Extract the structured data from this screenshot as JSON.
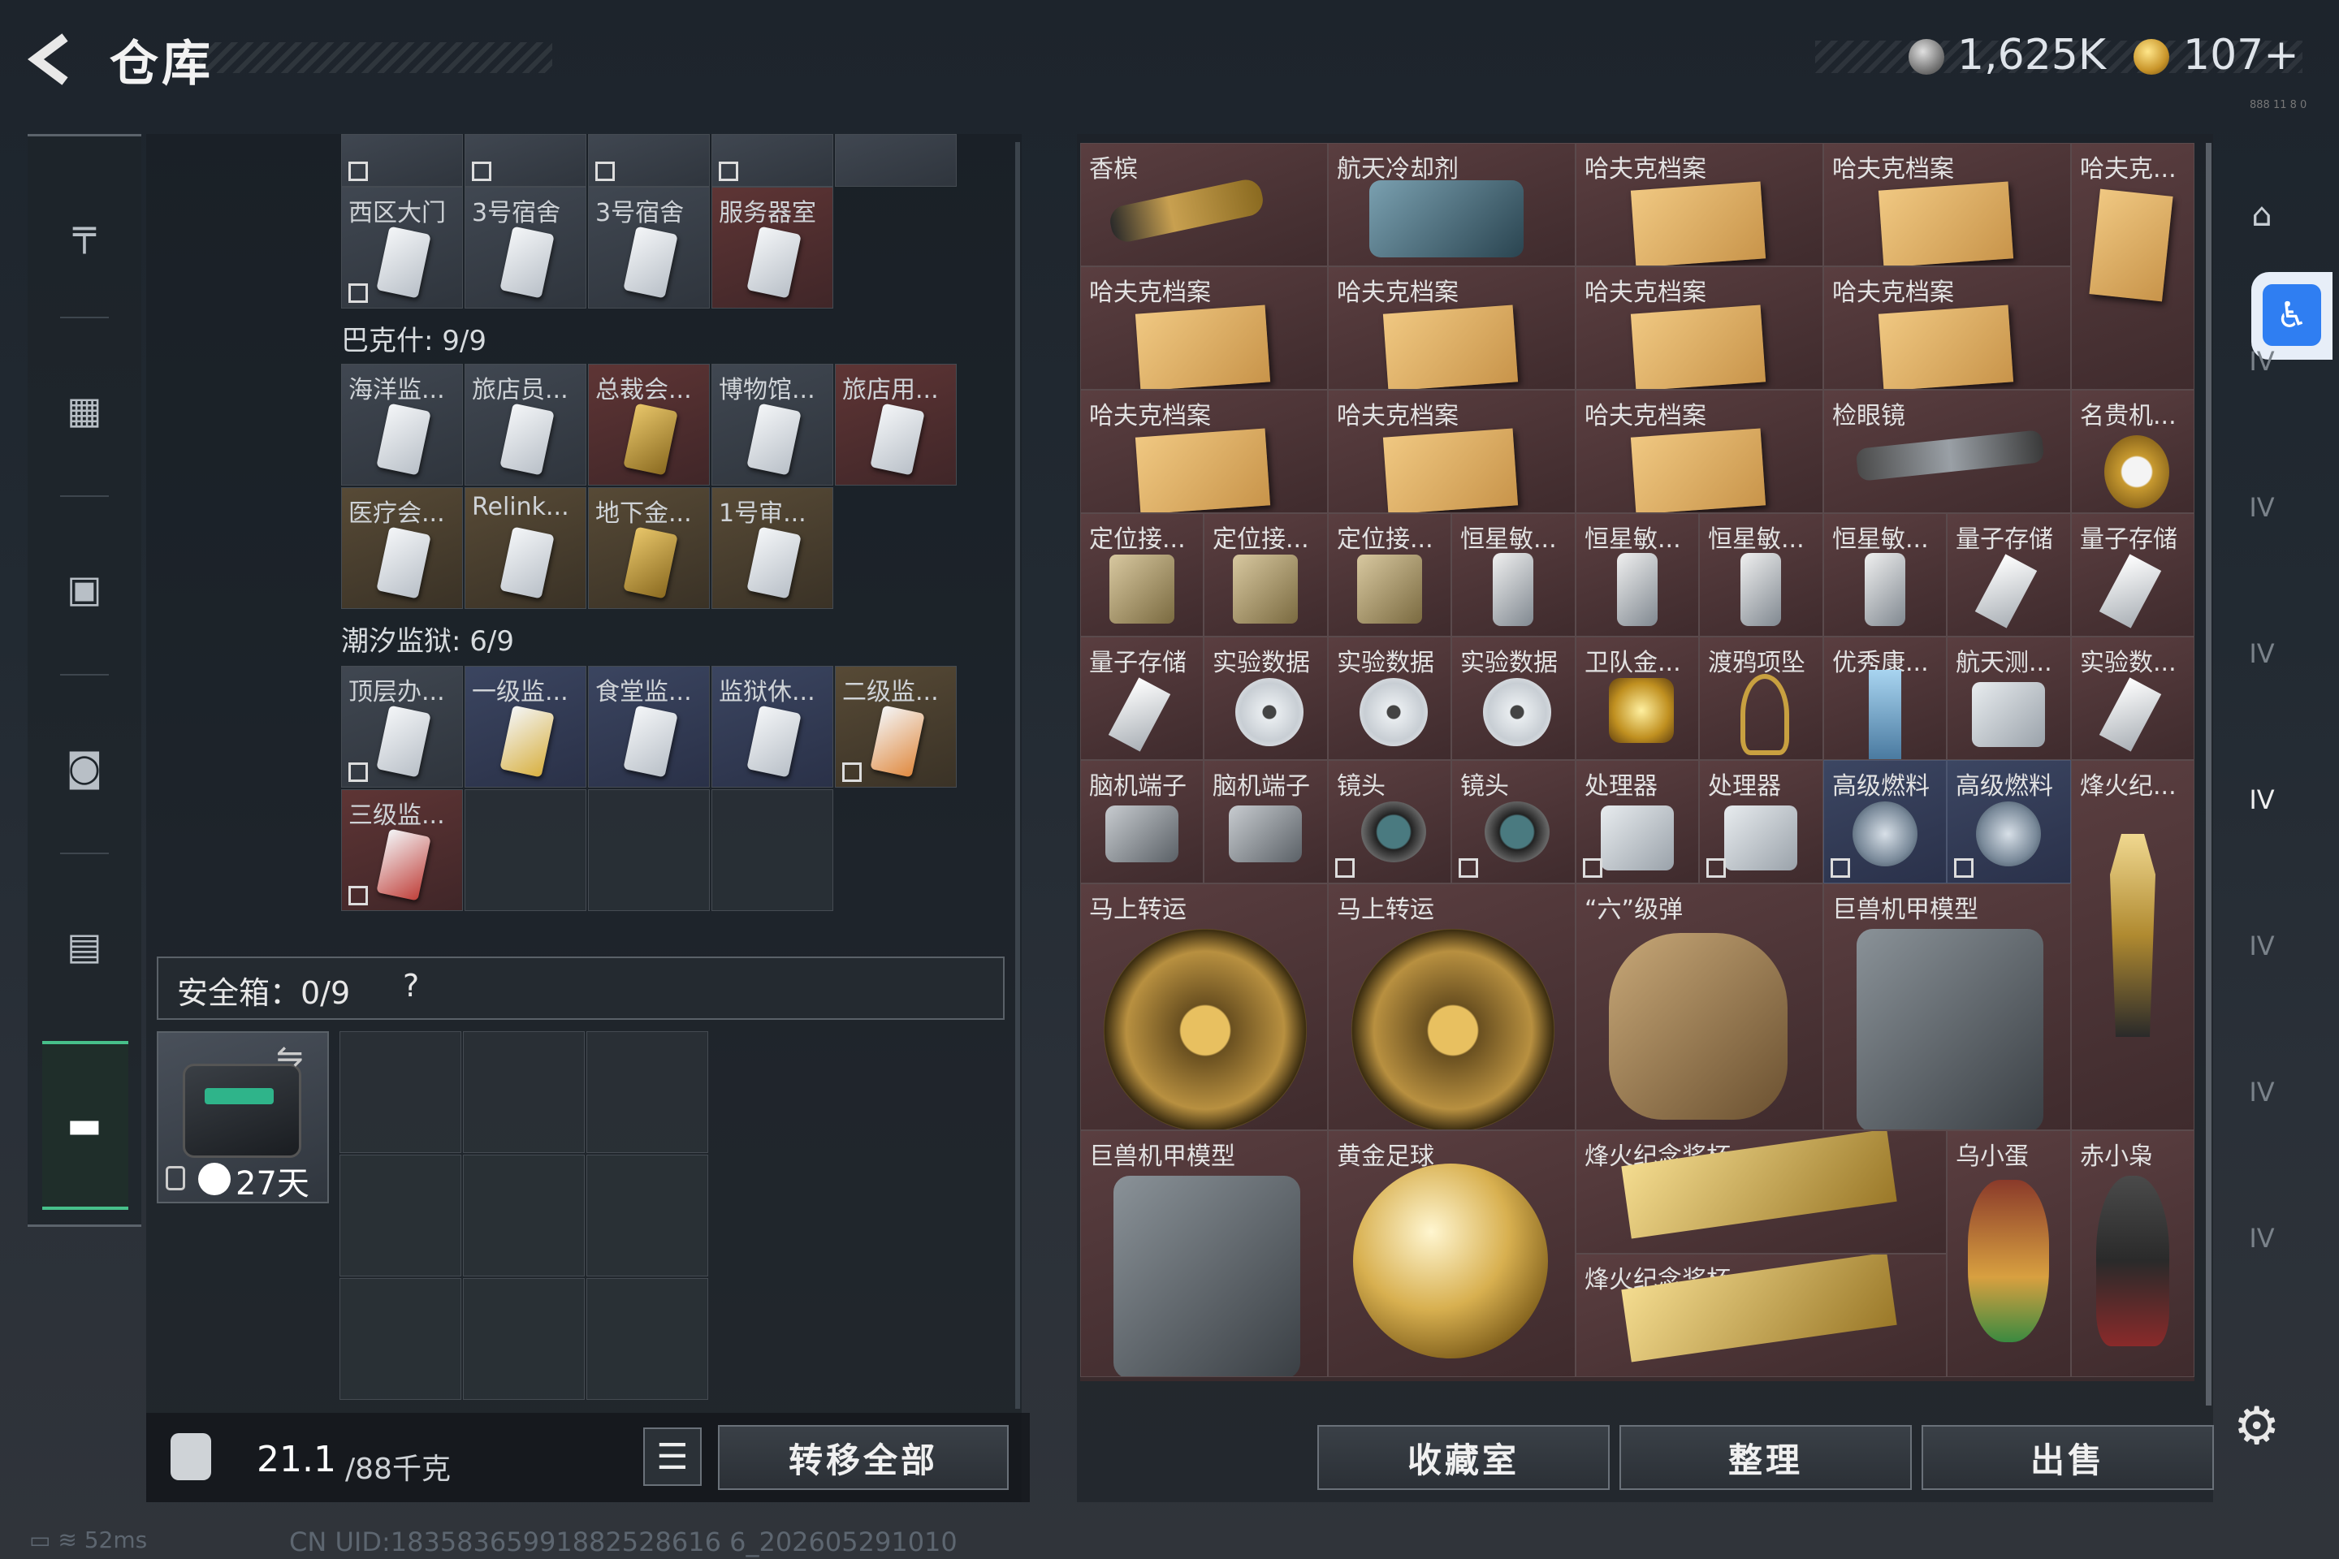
{
  "header": {
    "title": "仓库",
    "currency1": "1,625K",
    "currency2": "107+",
    "tiny_code": "888 11 8 0"
  },
  "left": {
    "top_row_labels": [
      "西区大门",
      "3号宿舍",
      "3号宿舍",
      "服务器室"
    ],
    "group1_title": "巴克什: 9/9",
    "group1_labels": [
      "海洋监...",
      "旅店员...",
      "总裁会...",
      "博物馆...",
      "旅店用...",
      "医疗会...",
      "Relink...",
      "地下金...",
      "1号审..."
    ],
    "group2_title": "潮汐监狱: 6/9",
    "group2_labels": [
      "顶层办...",
      "一级监...",
      "食堂监...",
      "监狱休...",
      "二级监...",
      "三级监..."
    ],
    "safe": {
      "label": "安全箱：0/9",
      "help": "?",
      "swap": "⇋",
      "days": "27天"
    },
    "weight": {
      "value": "21.1",
      "unit": "/88千克"
    },
    "list_icon": "☰",
    "transfer_all": "转移全部"
  },
  "right": {
    "row1": [
      "香槟",
      "航天冷却剂",
      "哈夫克档案",
      "哈夫克档案",
      "哈夫克..."
    ],
    "row2": [
      "哈夫克档案",
      "哈夫克档案",
      "哈夫克档案",
      "哈夫克档案"
    ],
    "row3": [
      "哈夫克档案",
      "哈夫克档案",
      "哈夫克档案",
      "检眼镜",
      "名贵机..."
    ],
    "row4": [
      "定位接...",
      "定位接...",
      "定位接...",
      "恒星敏...",
      "恒星敏...",
      "恒星敏...",
      "恒星敏...",
      "量子存储",
      "量子存储"
    ],
    "row5": [
      "量子存储",
      "实验数据",
      "实验数据",
      "实验数据",
      "卫队金...",
      "渡鸦项坠",
      "优秀康...",
      "航天测...",
      "实验数..."
    ],
    "row6": [
      "脑机端子",
      "脑机端子",
      "镜头",
      "镜头",
      "处理器",
      "处理器",
      "高级燃料",
      "高级燃料",
      "烽火纪..."
    ],
    "row7": [
      "马上转运",
      "马上转运",
      "“六”级弹",
      "巨兽机甲模型"
    ],
    "row8": [
      "巨兽机甲模型",
      "黄金足球",
      "烽火纪念奖杯",
      "烽火纪念奖杯",
      "乌小蛋",
      "赤小枭"
    ],
    "buttons": {
      "collection": "收藏室",
      "sort": "整理",
      "sell": "出售"
    }
  },
  "right_sidebar": {
    "tiers": [
      "IV",
      "IV",
      "IV",
      "IV",
      "IV",
      "IV",
      "IV"
    ]
  },
  "status": {
    "ping": "52ms",
    "uid": "CN UID:18358365991882528616 6_202605291010"
  }
}
